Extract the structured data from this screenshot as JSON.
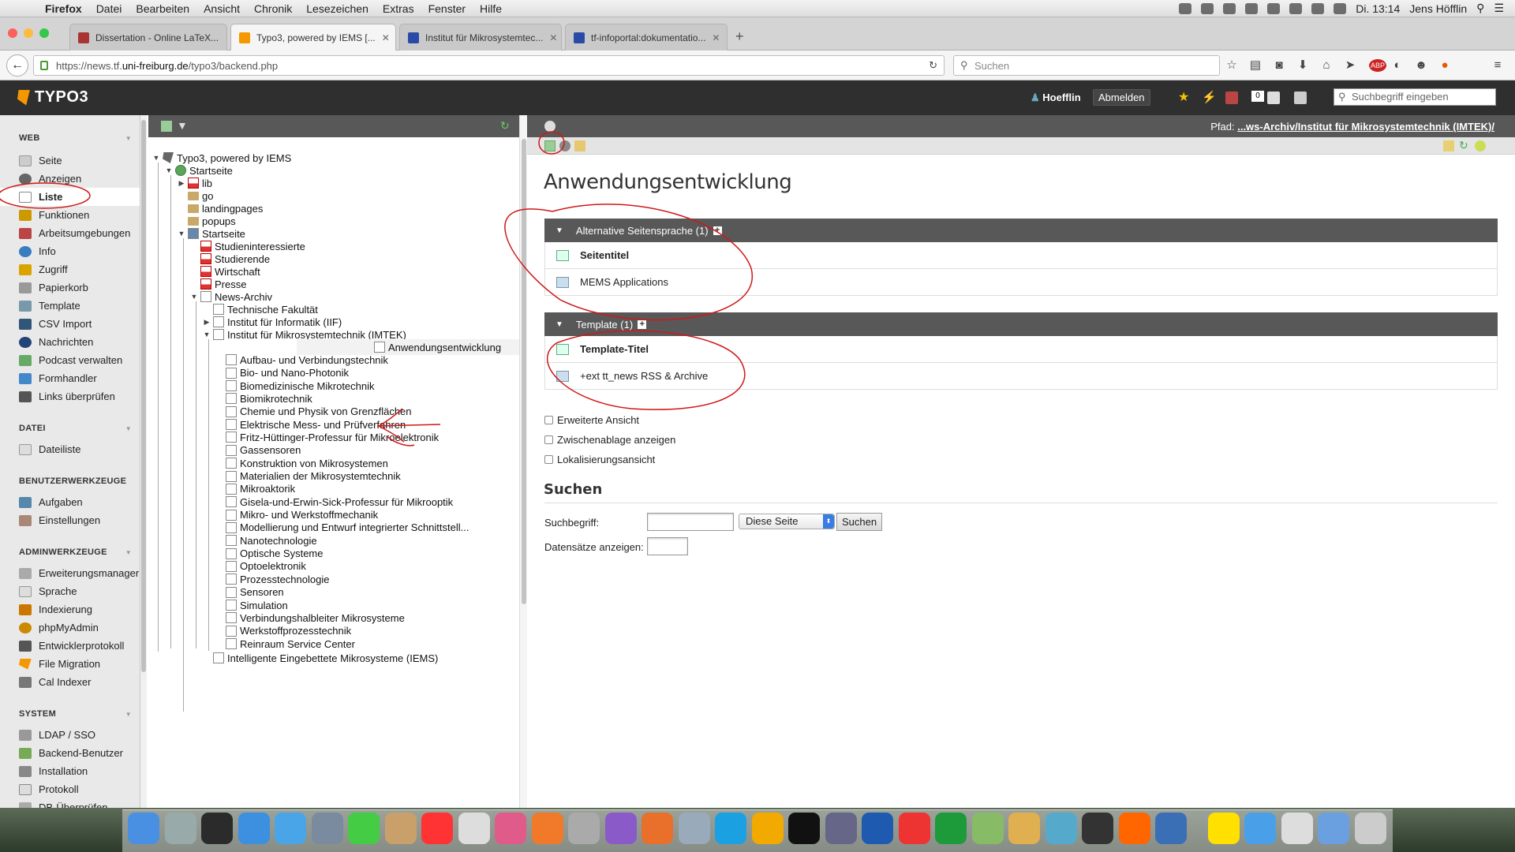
{
  "menubar": {
    "app": "Firefox",
    "items": [
      "Datei",
      "Bearbeiten",
      "Ansicht",
      "Chronik",
      "Lesezeichen",
      "Extras",
      "Fenster",
      "Hilfe"
    ],
    "clock": "Di. 13:14",
    "user": "Jens Höfflin"
  },
  "tabs": [
    {
      "title": "Dissertation - Online LaTeX..."
    },
    {
      "title": "Typo3, powered by IEMS [..."
    },
    {
      "title": "Institut für Mikrosystemtec..."
    },
    {
      "title": "tf-infoportal:dokumentatio..."
    }
  ],
  "nav": {
    "url_prefix": "https://news.tf.",
    "url_domain": "uni-freiburg.de",
    "url_path": "/typo3/backend.php",
    "search_placeholder": "Suchen"
  },
  "typo3": {
    "logo": "TYPO3",
    "user": "Hoefflin",
    "logout": "Abmelden",
    "search_placeholder": "Suchbegriff eingeben",
    "badge": "0"
  },
  "modules": {
    "web_title": "WEB",
    "web": [
      "Seite",
      "Anzeigen",
      "Liste",
      "Funktionen",
      "Arbeitsumgebungen",
      "Info",
      "Zugriff",
      "Papierkorb",
      "Template",
      "CSV Import",
      "Nachrichten",
      "Podcast verwalten",
      "Formhandler",
      "Links überprüfen"
    ],
    "datei_title": "DATEI",
    "datei": [
      "Dateiliste"
    ],
    "user_title": "BENUTZERWERKZEUGE",
    "user": [
      "Aufgaben",
      "Einstellungen"
    ],
    "admin_title": "ADMINWERKZEUGE",
    "admin": [
      "Erweiterungsmanager",
      "Sprache",
      "Indexierung",
      "phpMyAdmin",
      "Entwicklerprotokoll",
      "File Migration",
      "Cal Indexer"
    ],
    "system_title": "SYSTEM",
    "system": [
      "LDAP / SSO",
      "Backend-Benutzer",
      "Installation",
      "Protokoll",
      "DB-Überprüfen"
    ]
  },
  "tree": {
    "root": "Typo3, powered by IEMS",
    "startseite": "Startseite",
    "top": [
      "lib",
      "go",
      "landingpages",
      "popups"
    ],
    "startseite2": "Startseite",
    "sub": [
      "Studieninteressierte",
      "Studierende",
      "Wirtschaft",
      "Presse"
    ],
    "news": "News-Archiv",
    "news_sub": [
      "Technische Fakultät",
      "Institut für Informatik (IIF)",
      "Institut für Mikrosystemtechnik (IMTEK)"
    ],
    "imtek": [
      "Anwendungsentwicklung",
      "Aufbau- und Verbindungstechnik",
      "Bio- und Nano-Photonik",
      "Biomedizinische Mikrotechnik",
      "Biomikrotechnik",
      "Chemie und Physik von Grenzflächen",
      "Elektrische Mess- und Prüfverfahren",
      "Fritz-Hüttinger-Professur für Mikroelektronik",
      "Gassensoren",
      "Konstruktion von Mikrosystemen",
      "Materialien der Mikrosystemtechnik",
      "Mikroaktorik",
      "Gisela-und-Erwin-Sick-Professur für Mikrooptik",
      "Mikro- und Werkstoffmechanik",
      "Modellierung und Entwurf integrierter Schnittstell...",
      "Nanotechnologie",
      "Optische Systeme",
      "Optoelektronik",
      "Prozesstechnologie",
      "Sensoren",
      "Simulation",
      "Verbindungshalbleiter Mikrosysteme",
      "Werkstoffprozesstechnik",
      "Reinraum Service Center"
    ],
    "last": "Intelligente Eingebettete Mikrosysteme (IEMS)"
  },
  "content": {
    "path_label": "Pfad:",
    "path": "...ws-Archiv/Institut für Mikrosystemtechnik (IMTEK)/",
    "title": "Anwendungsentwicklung",
    "table1_title": "Alternative Seitensprache (1)",
    "table1_col": "Seitentitel",
    "table1_row": "MEMS Applications",
    "table2_title": "Template (1)",
    "table2_col": "Template-Titel",
    "table2_row": "+ext tt_news RSS & Archive",
    "checks": [
      "Erweiterte Ansicht",
      "Zwischenablage anzeigen",
      "Lokalisierungsansicht"
    ],
    "search_title": "Suchen",
    "search_label": "Suchbegriff:",
    "search_scope": "Diese Seite",
    "search_button": "Suchen",
    "records_label": "Datensätze anzeigen:"
  },
  "colors": {
    "accent": "#f49700",
    "typo3_dark": "#2f2f2f",
    "header_gray": "#585858",
    "annotation": "#d01818"
  }
}
